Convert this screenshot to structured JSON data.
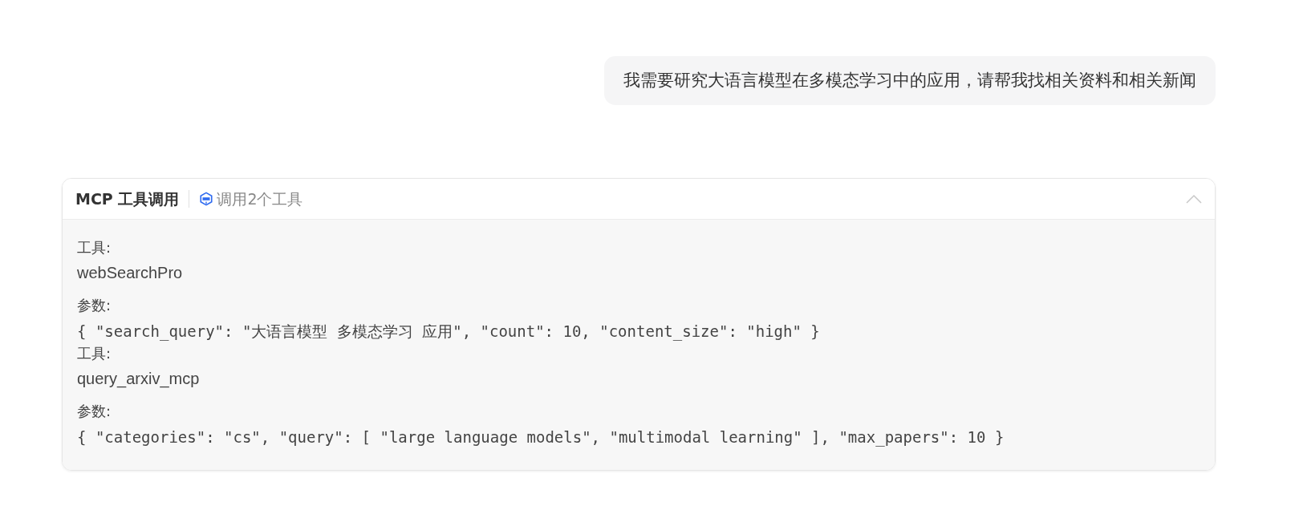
{
  "user_message": "我需要研究大语言模型在多模态学习中的应用，请帮我找相关资料和相关新闻",
  "tool_panel": {
    "title": "MCP 工具调用",
    "summary": "调用2个工具",
    "expanded": true,
    "calls": [
      {
        "tool_label": "工具:",
        "tool_name": "webSearchPro",
        "params_label": "参数:",
        "params": "{ \"search_query\": \"大语言模型 多模态学习 应用\", \"count\": 10, \"content_size\": \"high\" }"
      },
      {
        "tool_label": "工具:",
        "tool_name": "query_arxiv_mcp",
        "params_label": "参数:",
        "params": "{ \"categories\": \"cs\", \"query\": [ \"large language models\", \"multimodal learning\" ], \"max_papers\": 10 }"
      }
    ]
  }
}
